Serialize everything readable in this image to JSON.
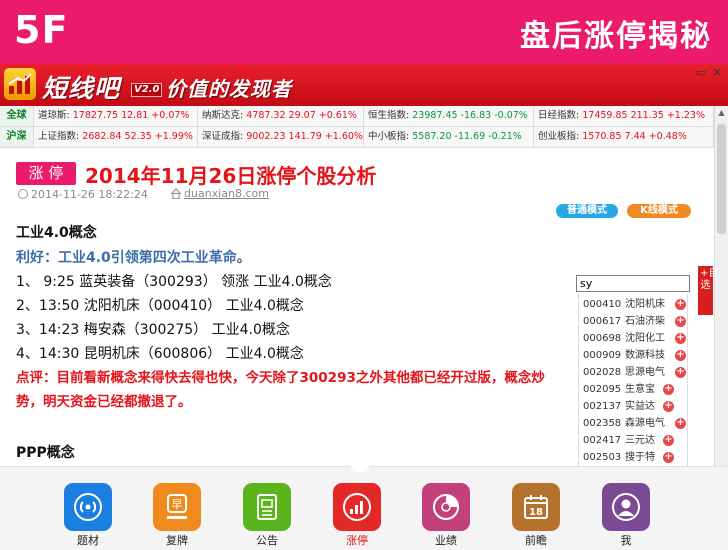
{
  "header": {
    "logo": "5F",
    "title": "盘后涨停揭秘"
  },
  "banner": {
    "brand": "短线吧",
    "version": "V2.0",
    "slogan": "价值的发现者",
    "minimize": "▭",
    "close": "✕"
  },
  "ticker": {
    "row1_label": "全球",
    "row1": [
      {
        "name": "道琼斯:",
        "value": "17827.75 12.81 +0.07%",
        "dir": "up"
      },
      {
        "name": "纳斯达克:",
        "value": "4787.32 29.07 +0.61%",
        "dir": "up"
      },
      {
        "name": "恒生指数:",
        "value": "23987.45 -16.83 -0.07%",
        "dir": "down"
      },
      {
        "name": "日经指数:",
        "value": "17459.85 211.35 +1.23%",
        "dir": "up"
      }
    ],
    "row2_label": "沪深",
    "row2": [
      {
        "name": "上证指数:",
        "value": "2682.84 52.35 +1.99%",
        "dir": "up"
      },
      {
        "name": "深证成指:",
        "value": "9002.23 141.79 +1.60%",
        "dir": "up"
      },
      {
        "name": "中小板指:",
        "value": "5587.20 -11.69 -0.21%",
        "dir": "down"
      },
      {
        "name": "创业板指:",
        "value": "1570.85 7.44 +0.48%",
        "dir": "up"
      }
    ]
  },
  "article": {
    "badge": "涨 停",
    "title": "2014年11月26日涨停个股分析",
    "time": "2014-11-26 18:22:24",
    "site": "duanxian8.com",
    "mode_normal": "普通模式",
    "mode_kline": "K线模式",
    "section1_title": "工业4.0概念",
    "benefit": "利好：工业4.0引领第四次工业革命。",
    "items": [
      "1、 9:25  蓝英装备（300293） 领涨 工业4.0概念",
      "2、13:50  沈阳机床（000410）  工业4.0概念",
      "3、14:23  梅安森（300275）  工业4.0概念",
      "4、14:30  昆明机床（600806）  工业4.0概念"
    ],
    "comment_line1": "点评：目前看新概念来得快去得也快，今天除了300293之外其他都已经开过版，概念炒",
    "comment_line2": "势，明天资金已经都撤退了。",
    "section2_title": "PPP概念"
  },
  "search": {
    "value": "sy",
    "results": [
      {
        "code": "000410",
        "name": "沈阳机床"
      },
      {
        "code": "000617",
        "name": "石油济柴"
      },
      {
        "code": "000698",
        "name": "沈阳化工"
      },
      {
        "code": "000909",
        "name": "数源科技"
      },
      {
        "code": "002028",
        "name": "思源电气"
      },
      {
        "code": "002095",
        "name": "生意宝"
      },
      {
        "code": "002137",
        "name": "实益达"
      },
      {
        "code": "002358",
        "name": "森源电气"
      },
      {
        "code": "002417",
        "name": "三元达"
      },
      {
        "code": "002503",
        "name": "搜于特"
      }
    ],
    "plus": "+",
    "zixuan": "+自选"
  },
  "dock": [
    {
      "label": "题材",
      "color": "#1a7fe0",
      "icon": "broadcast-icon"
    },
    {
      "label": "复牌",
      "color": "#f08a1c",
      "icon": "stamp-icon"
    },
    {
      "label": "公告",
      "color": "#5bb41c",
      "icon": "notice-icon"
    },
    {
      "label": "涨停",
      "color": "#e32828",
      "icon": "bar-chart-icon"
    },
    {
      "label": "业绩",
      "color": "#c4407a",
      "icon": "pie-chart-icon"
    },
    {
      "label": "前瞻",
      "color": "#b5722a",
      "icon": "calendar-icon"
    },
    {
      "label": "我",
      "color": "#7a4a94",
      "icon": "user-icon"
    }
  ],
  "calendar_day": "18"
}
